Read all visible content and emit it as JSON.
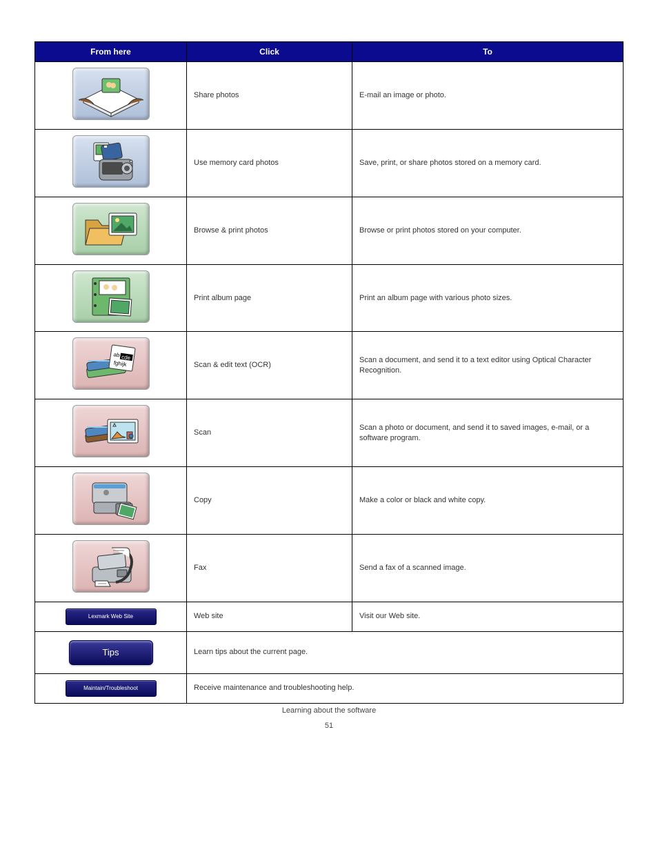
{
  "table": {
    "headers": [
      "From here",
      "Click",
      "To"
    ],
    "rows": [
      {
        "icon": "share-photos-icon",
        "tile": "blue",
        "name": "Share photos",
        "desc": "E-mail an image or photo.",
        "height": "tall"
      },
      {
        "icon": "memory-card-icon",
        "tile": "blue",
        "name": "Use memory card photos",
        "desc": "Save, print, or share photos stored on a memory card.",
        "height": "tall"
      },
      {
        "icon": "browse-photos-icon",
        "tile": "green",
        "name": "Browse & print photos",
        "desc": "Browse or print photos stored on your computer.",
        "height": "tall"
      },
      {
        "icon": "album-page-icon",
        "tile": "green",
        "name": "Print album page",
        "desc": "Print an album page with various photo sizes.",
        "height": "tall"
      },
      {
        "icon": "scan-edit-text-icon",
        "tile": "pink",
        "name": "Scan & edit text (OCR)",
        "desc": "Scan a document, and send it to a text editor using Optical Character Recognition.",
        "height": "tall"
      },
      {
        "icon": "scan-icon",
        "tile": "pink",
        "name": "Scan",
        "desc": "Scan a photo or document, and send it to saved images, e-mail, or a software program.",
        "height": "tall"
      },
      {
        "icon": "copy-icon",
        "tile": "pink",
        "name": "Copy",
        "desc": "Make a color or black and white copy.",
        "height": "tall"
      },
      {
        "icon": "fax-icon",
        "tile": "pink",
        "name": "Fax",
        "desc": "Send a fax of a scanned image.",
        "height": "tall"
      },
      {
        "icon": "website-button-icon",
        "button": "bar",
        "label": "Lexmark Web Site",
        "name": "Web site",
        "desc": "Visit our Web site.",
        "height": "short"
      },
      {
        "icon": "tips-button-icon",
        "button": "pill",
        "label": "Tips",
        "name": "Tips",
        "desc": "Learn tips about the current page.",
        "height": "short",
        "span_desc": true
      },
      {
        "icon": "maintain-button-icon",
        "button": "bar",
        "label": "Maintain/Troubleshoot",
        "name": "Maintain/Troubleshoot",
        "desc": "Receive maintenance and troubleshooting help.",
        "height": "short",
        "span_desc": true
      }
    ]
  },
  "footer": "Learning about the software",
  "page_number": "51"
}
